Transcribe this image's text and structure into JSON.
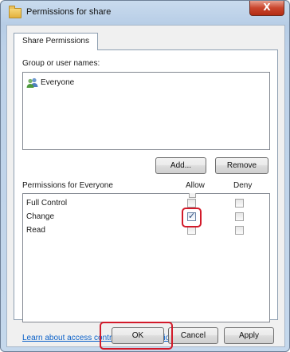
{
  "window": {
    "title": "Permissions for share",
    "close_glyph": "X"
  },
  "tabs": [
    {
      "label": "Share Permissions"
    }
  ],
  "groups": {
    "label": "Group or user names:",
    "items": [
      {
        "name": "Everyone",
        "icon": "users-icon"
      }
    ]
  },
  "buttons": {
    "add": "Add...",
    "remove": "Remove",
    "ok": "OK",
    "cancel": "Cancel",
    "apply": "Apply"
  },
  "permissions": {
    "label": "Permissions for Everyone",
    "allow_header": "Allow",
    "deny_header": "Deny",
    "rows": [
      {
        "name": "Full Control",
        "allow": false,
        "deny": false
      },
      {
        "name": "Change",
        "allow": true,
        "deny": false
      },
      {
        "name": "Read",
        "allow": false,
        "deny": false
      }
    ]
  },
  "link": "Learn about access control and permissions",
  "colors": {
    "highlight": "#d21a2a",
    "link": "#0b61c8"
  }
}
